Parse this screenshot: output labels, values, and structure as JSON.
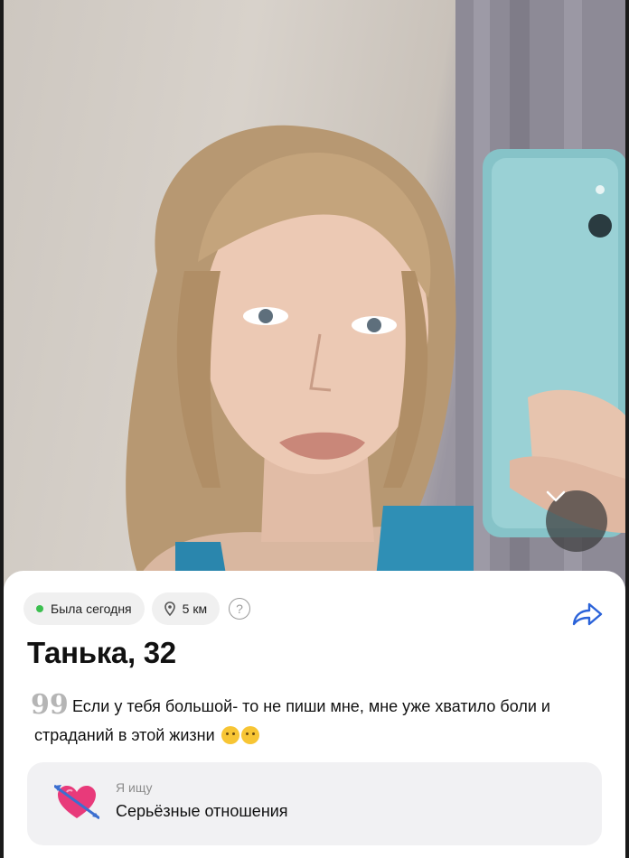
{
  "profile": {
    "status": "Была сегодня",
    "distance": "5 км",
    "help_symbol": "?",
    "name_age": "Танька, 32",
    "bio": "Если у тебя большой- то не пиши мне, мне уже хватило боли и страданий в этой жизни",
    "bio_emojis": [
      "worried-face",
      "smirking-face"
    ],
    "looking_for": {
      "label": "Я ищу",
      "value": "Серьёзные отношения",
      "icon": "heart-with-arrow-icon"
    }
  },
  "colors": {
    "online_dot": "#3bbf4f",
    "accent": "#2b63d9",
    "card_bg": "#ffffff",
    "chip_bg": "#f0f0f0",
    "heart": "#e83a7a"
  }
}
